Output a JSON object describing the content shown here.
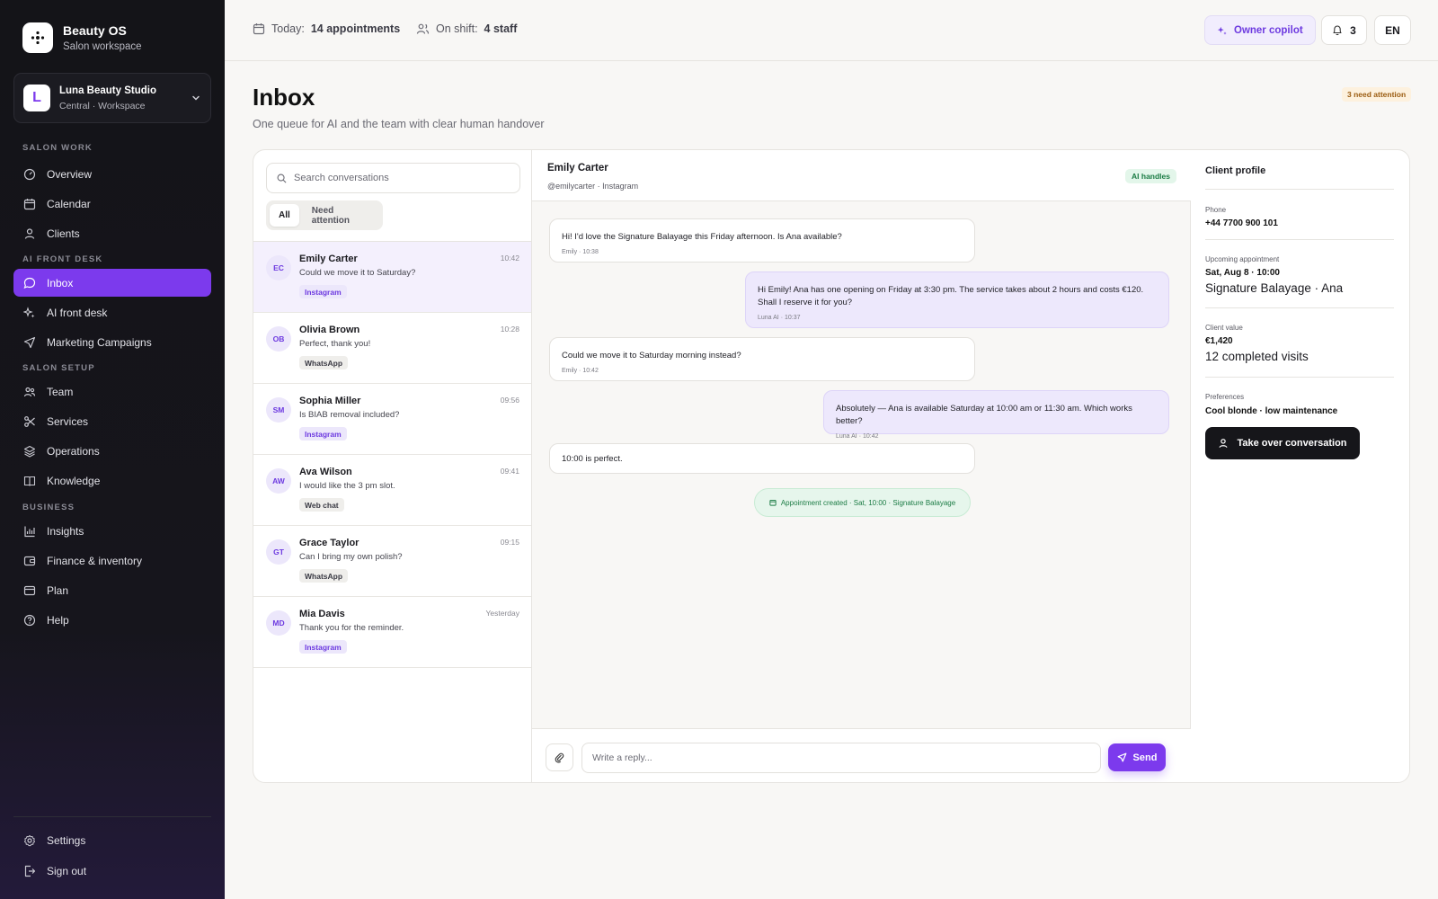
{
  "brand": {
    "title": "Beauty OS",
    "subtitle": "Salon workspace"
  },
  "workspace": {
    "initial": "L",
    "name": "Luna Beauty Studio",
    "sub": "Central · Workspace"
  },
  "sections": {
    "salon_work": "SALON WORK",
    "ai_front_desk": "AI FRONT DESK",
    "salon_setup": "SALON SETUP",
    "business": "BUSINESS"
  },
  "nav": {
    "overview": "Overview",
    "calendar": "Calendar",
    "clients": "Clients",
    "inbox": "Inbox",
    "ai_front_desk": "AI front desk",
    "marketing": "Marketing Campaigns",
    "team": "Team",
    "services": "Services",
    "operations": "Operations",
    "knowledge": "Knowledge",
    "insights": "Insights",
    "finance": "Finance & inventory",
    "plan": "Plan",
    "help": "Help",
    "settings": "Settings",
    "sign_out": "Sign out"
  },
  "topbar": {
    "today_label": "Today:",
    "today_value": "14 appointments",
    "shift_label": "On shift:",
    "shift_value": "4 staff",
    "copilot": "Owner copilot",
    "notifications": "3",
    "language": "EN"
  },
  "page": {
    "title": "Inbox",
    "subtitle": "One queue for AI and the team with clear human handover",
    "attention_badge": "3 need attention"
  },
  "list": {
    "search_placeholder": "Search conversations",
    "tabs": {
      "all": "All",
      "attention": "Need attention"
    },
    "conversations": [
      {
        "initials": "EC",
        "name": "Emily Carter",
        "time": "10:42",
        "snippet": "Could we move it to Saturday?",
        "channel": "Instagram"
      },
      {
        "initials": "OB",
        "name": "Olivia Brown",
        "time": "10:28",
        "snippet": "Perfect, thank you!",
        "channel": "WhatsApp"
      },
      {
        "initials": "SM",
        "name": "Sophia Miller",
        "time": "09:56",
        "snippet": "Is BIAB removal included?",
        "channel": "Instagram"
      },
      {
        "initials": "AW",
        "name": "Ava Wilson",
        "time": "09:41",
        "snippet": "I would like the 3 pm slot.",
        "channel": "Web chat"
      },
      {
        "initials": "GT",
        "name": "Grace Taylor",
        "time": "09:15",
        "snippet": "Can I bring my own polish?",
        "channel": "WhatsApp"
      },
      {
        "initials": "MD",
        "name": "Mia Davis",
        "time": "Yesterday",
        "snippet": "Thank you for the reminder.",
        "channel": "Instagram"
      }
    ]
  },
  "chat": {
    "name": "Emily Carter",
    "handle": "@emilycarter · Instagram",
    "status": "AI handles",
    "messages": [
      {
        "text": "Hi! I'd love the Signature Balayage this Friday afternoon. Is Ana available?",
        "meta": "Emily · 10:38"
      },
      {
        "text": "Hi Emily! Ana has one opening on Friday at 3:30 pm. The service takes about 2 hours and costs €120. Shall I reserve it for you?",
        "meta": "Luna AI · 10:37"
      },
      {
        "text": "Could we move it to Saturday morning instead?",
        "meta": "Emily · 10:42"
      },
      {
        "text": "Absolutely — Ana is available Saturday at 10:00 am or 11:30 am. Which works better?",
        "meta": "Luna AI · 10:42"
      },
      {
        "text": "10:00 is perfect.",
        "meta": ""
      }
    ],
    "system": "Appointment created · Sat, 10:00 · Signature Balayage",
    "reply_placeholder": "Write a reply...",
    "send": "Send"
  },
  "profile": {
    "title": "Client profile",
    "phone_label": "Phone",
    "phone": "+44 7700 900 101",
    "appt_label": "Upcoming appointment",
    "appt_date": "Sat, Aug 8 · 10:00",
    "appt_service": "Signature Balayage · Ana",
    "value_label": "Client value",
    "value": "€1,420",
    "visits": "12 completed visits",
    "pref_label": "Preferences",
    "pref": "Cool blonde · low maintenance",
    "takeover": "Take over conversation"
  },
  "colors": {
    "accent": "#7c3aed",
    "sidebar": "#141418",
    "ai_green": "#1c7c45",
    "instagram_tag": "#ece7fb",
    "neutral_tag": "#efeeeb"
  }
}
